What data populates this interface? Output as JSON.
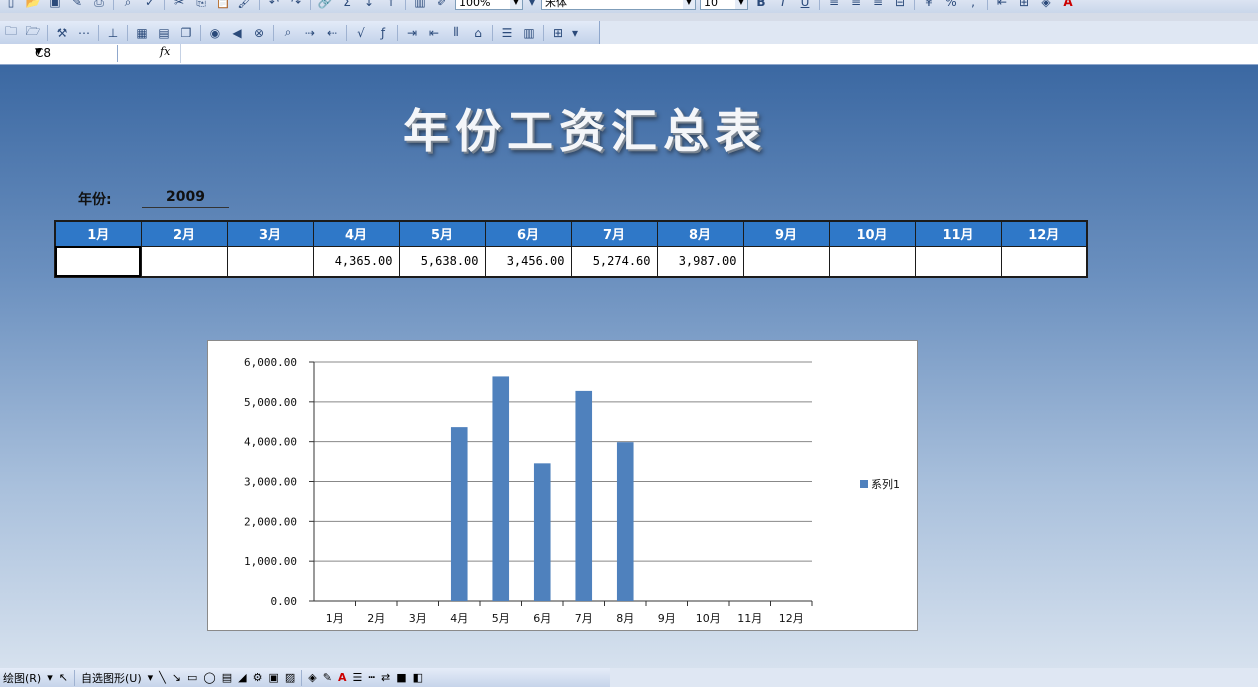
{
  "toolbar": {
    "zoom": "100%",
    "font_name": "宋体",
    "font_size": "10"
  },
  "formula_bar": {
    "name_box": "C8",
    "fx_label": "fx",
    "formula": ""
  },
  "sheet": {
    "title": "年份工资汇总表",
    "year_label": "年份:",
    "year_value": "2009",
    "months": [
      "1月",
      "2月",
      "3月",
      "4月",
      "5月",
      "6月",
      "7月",
      "8月",
      "9月",
      "10月",
      "11月",
      "12月"
    ],
    "salaries": [
      "",
      "",
      "",
      "4,365.00",
      "5,638.00",
      "3,456.00",
      "5,274.60",
      "3,987.00",
      "",
      "",
      "",
      ""
    ]
  },
  "chart_data": {
    "type": "bar",
    "categories": [
      "1月",
      "2月",
      "3月",
      "4月",
      "5月",
      "6月",
      "7月",
      "8月",
      "9月",
      "10月",
      "11月",
      "12月"
    ],
    "series": [
      {
        "name": "系列1",
        "values": [
          0,
          0,
          0,
          4365.0,
          5638.0,
          3456.0,
          5274.6,
          3987.0,
          0,
          0,
          0,
          0
        ],
        "color": "#4f81bd"
      }
    ],
    "ylim": [
      0,
      6000
    ],
    "yticks": [
      "0.00",
      "1,000.00",
      "2,000.00",
      "3,000.00",
      "4,000.00",
      "5,000.00",
      "6,000.00"
    ],
    "grid": true,
    "legend": "right"
  },
  "drawbar": {
    "draw_label": "绘图(R)",
    "autoshape_label": "自选图形(U)"
  }
}
